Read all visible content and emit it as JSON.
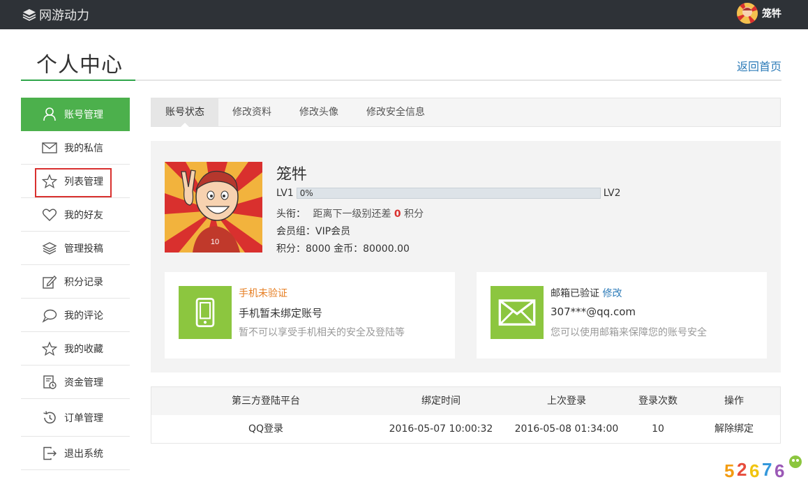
{
  "topbar": {
    "brand": "网游动力",
    "username": "笼牪"
  },
  "header": {
    "title": "个人中心",
    "back_home": "返回首页"
  },
  "sidebar": {
    "items": [
      {
        "label": "账号管理",
        "icon": "user-icon"
      },
      {
        "label": "我的私信",
        "icon": "mail-icon"
      },
      {
        "label": "列表管理",
        "icon": "star-icon"
      },
      {
        "label": "我的好友",
        "icon": "heart-icon"
      },
      {
        "label": "管理投稿",
        "icon": "layers-icon"
      },
      {
        "label": "积分记录",
        "icon": "edit-icon"
      },
      {
        "label": "我的评论",
        "icon": "chat-icon"
      },
      {
        "label": "我的收藏",
        "icon": "star-icon"
      },
      {
        "label": "资金管理",
        "icon": "finance-icon"
      },
      {
        "label": "订单管理",
        "icon": "history-icon"
      },
      {
        "label": "退出系统",
        "icon": "logout-icon"
      }
    ]
  },
  "tabs": [
    "账号状态",
    "修改资料",
    "修改头像",
    "修改安全信息"
  ],
  "profile": {
    "name": "笼牪",
    "level_from": "LV1",
    "level_to": "LV2",
    "progress_text": "0%",
    "progress": 0,
    "title_label": "头衔：",
    "title_text": "距离下一级别还差",
    "title_points": "0",
    "title_unit": "积分",
    "group": "会员组：VIP会员",
    "points": "积分：8000 金币：80000.00"
  },
  "phone_card": {
    "status": "手机未验证",
    "line2": "手机暂未绑定账号",
    "line3": "暂不可以享受手机相关的安全及登陆等"
  },
  "email_card": {
    "status": "邮箱已验证",
    "action": "修改",
    "line2": "307***@qq.com",
    "line3": "您可以使用邮箱来保障您的账号安全"
  },
  "bind_table": {
    "headers": [
      "第三方登陆平台",
      "绑定时间",
      "上次登录",
      "登录次数",
      "操作"
    ],
    "rows": [
      [
        "QQ登录",
        "2016-05-07 10:00:32",
        "2016-05-08 01:34:00",
        "10",
        "解除绑定"
      ]
    ]
  },
  "colors": {
    "accent": "#4cb04c",
    "topbar": "#2e3237",
    "link": "#2c7bb8",
    "card_icon": "#8cc63f"
  }
}
